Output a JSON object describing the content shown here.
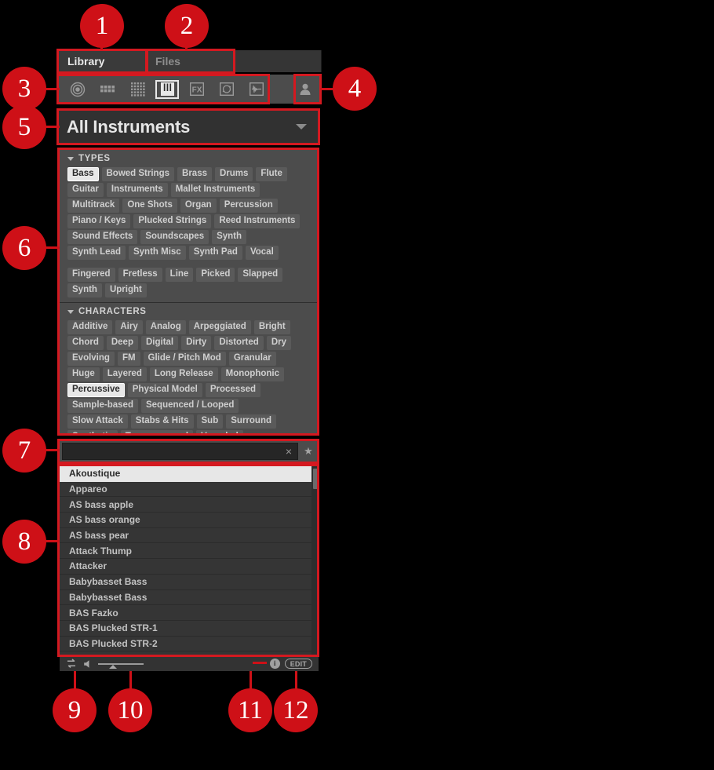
{
  "app": {
    "panel_name": "Browser"
  },
  "tabs": [
    {
      "label": "Library",
      "active": true
    },
    {
      "label": "Files",
      "active": false
    }
  ],
  "icon_bar": {
    "icons": [
      {
        "name": "all-icon",
        "selected": false
      },
      {
        "name": "drumkit-grid-icon",
        "selected": false
      },
      {
        "name": "dots-grid-icon",
        "selected": false
      },
      {
        "name": "keyboard-icon",
        "selected": true
      },
      {
        "name": "fx-icon",
        "selected": false
      },
      {
        "name": "loop-icon",
        "selected": false
      },
      {
        "name": "waveform-icon",
        "selected": false
      }
    ],
    "user_icon": {
      "name": "user-content-icon"
    }
  },
  "content_selector": {
    "value": "All Instruments",
    "caret": "chevron-down-icon"
  },
  "filters": {
    "types": {
      "heading": "TYPES",
      "rows": [
        [
          {
            "label": "Bass",
            "selected": true
          },
          {
            "label": "Bowed Strings",
            "selected": false
          },
          {
            "label": "Brass",
            "selected": false
          },
          {
            "label": "Drums",
            "selected": false
          },
          {
            "label": "Flute",
            "selected": false
          }
        ],
        [
          {
            "label": "Guitar",
            "selected": false
          },
          {
            "label": "Instruments",
            "selected": false
          },
          {
            "label": "Mallet Instruments",
            "selected": false
          }
        ],
        [
          {
            "label": "Multitrack",
            "selected": false
          },
          {
            "label": "One Shots",
            "selected": false
          },
          {
            "label": "Organ",
            "selected": false
          },
          {
            "label": "Percussion",
            "selected": false
          }
        ],
        [
          {
            "label": "Piano / Keys",
            "selected": false
          },
          {
            "label": "Plucked Strings",
            "selected": false
          },
          {
            "label": "Reed Instruments",
            "selected": false
          }
        ],
        [
          {
            "label": "Sound Effects",
            "selected": false
          },
          {
            "label": "Soundscapes",
            "selected": false
          },
          {
            "label": "Synth",
            "selected": false
          }
        ],
        [
          {
            "label": "Synth Lead",
            "selected": false
          },
          {
            "label": "Synth Misc",
            "selected": false
          },
          {
            "label": "Synth Pad",
            "selected": false
          },
          {
            "label": "Vocal",
            "selected": false
          }
        ]
      ],
      "subrows": [
        [
          {
            "label": "Fingered",
            "selected": false
          },
          {
            "label": "Fretless",
            "selected": false
          },
          {
            "label": "Line",
            "selected": false
          },
          {
            "label": "Picked",
            "selected": false
          },
          {
            "label": "Slapped",
            "selected": false
          }
        ],
        [
          {
            "label": "Synth",
            "selected": false
          },
          {
            "label": "Upright",
            "selected": false
          }
        ]
      ]
    },
    "characters": {
      "heading": "CHARACTERS",
      "rows": [
        [
          {
            "label": "Additive",
            "selected": false
          },
          {
            "label": "Airy",
            "selected": false
          },
          {
            "label": "Analog",
            "selected": false
          },
          {
            "label": "Arpeggiated",
            "selected": false
          },
          {
            "label": "Bright",
            "selected": false
          }
        ],
        [
          {
            "label": "Chord",
            "selected": false
          },
          {
            "label": "Deep",
            "selected": false
          },
          {
            "label": "Digital",
            "selected": false
          },
          {
            "label": "Dirty",
            "selected": false
          },
          {
            "label": "Distorted",
            "selected": false
          },
          {
            "label": "Dry",
            "selected": false
          }
        ],
        [
          {
            "label": "Evolving",
            "selected": false
          },
          {
            "label": "FM",
            "selected": false
          },
          {
            "label": "Glide / Pitch Mod",
            "selected": false
          },
          {
            "label": "Granular",
            "selected": false
          }
        ],
        [
          {
            "label": "Huge",
            "selected": false
          },
          {
            "label": "Layered",
            "selected": false
          },
          {
            "label": "Long Release",
            "selected": false
          },
          {
            "label": "Monophonic",
            "selected": false
          }
        ],
        [
          {
            "label": "Percussive",
            "selected": true
          },
          {
            "label": "Physical Model",
            "selected": false
          },
          {
            "label": "Processed",
            "selected": false
          }
        ],
        [
          {
            "label": "Sample-based",
            "selected": false
          },
          {
            "label": "Sequenced / Looped",
            "selected": false
          }
        ],
        [
          {
            "label": "Slow Attack",
            "selected": false
          },
          {
            "label": "Stabs & Hits",
            "selected": false
          },
          {
            "label": "Sub",
            "selected": false
          },
          {
            "label": "Surround",
            "selected": false
          }
        ],
        [
          {
            "label": "Synthetic",
            "selected": false
          },
          {
            "label": "Tempo-synced",
            "selected": false
          },
          {
            "label": "Vocoded",
            "selected": false
          }
        ]
      ]
    }
  },
  "search": {
    "value": "",
    "placeholder": "",
    "clear_icon": "×",
    "favorite_icon": "★"
  },
  "results": {
    "items": [
      {
        "label": "Akoustique",
        "selected": true
      },
      {
        "label": "Appareo",
        "selected": false
      },
      {
        "label": "AS bass apple",
        "selected": false
      },
      {
        "label": "AS bass orange",
        "selected": false
      },
      {
        "label": "AS bass pear",
        "selected": false
      },
      {
        "label": "Attack Thump",
        "selected": false
      },
      {
        "label": "Attacker",
        "selected": false
      },
      {
        "label": "Babybasset Bass",
        "selected": false
      },
      {
        "label": "Babybasset Bass",
        "selected": false
      },
      {
        "label": "BAS Fazko",
        "selected": false
      },
      {
        "label": "BAS Plucked STR-1",
        "selected": false
      },
      {
        "label": "BAS Plucked STR-2",
        "selected": false
      }
    ]
  },
  "bottom_bar": {
    "autoload_icon": "autoload-icon",
    "prehear_icon": "speaker-icon",
    "volume_slider": {
      "name": "prehear-volume-slider",
      "value": 33
    },
    "info_label": "i",
    "edit_label": "EDIT"
  },
  "callouts": [
    {
      "n": "1"
    },
    {
      "n": "2"
    },
    {
      "n": "3"
    },
    {
      "n": "4"
    },
    {
      "n": "5"
    },
    {
      "n": "6"
    },
    {
      "n": "7"
    },
    {
      "n": "8"
    },
    {
      "n": "9"
    },
    {
      "n": "10"
    },
    {
      "n": "11"
    },
    {
      "n": "12"
    }
  ],
  "colors": {
    "callout_red": "#ce1017",
    "panel_bg": "#4c4c4c",
    "selected_chip": "#e7e7e7"
  }
}
